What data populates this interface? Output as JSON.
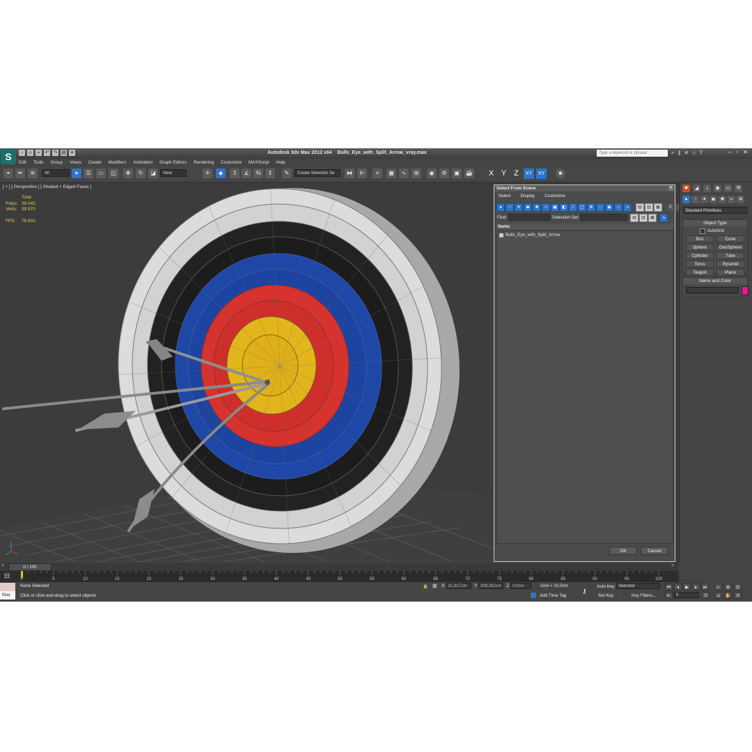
{
  "title": {
    "app": "Autodesk 3ds Max  2012 x64",
    "file": "Bulls_Eye_with_Split_Arrow_vray.max",
    "search_placeholder": "Type a keyword or phrase"
  },
  "menu": [
    "Edit",
    "Tools",
    "Group",
    "Views",
    "Create",
    "Modifiers",
    "Animation",
    "Graph Editors",
    "Rendering",
    "Customize",
    "MAXScript",
    "Help"
  ],
  "toolbar": {
    "filter_value": "All",
    "view_value": "View",
    "selection_set_placeholder": "Create Selection Se",
    "snap_labels": [
      "3",
      "%"
    ],
    "axes": [
      "X",
      "Y",
      "Z",
      "XY",
      "XY"
    ]
  },
  "viewport": {
    "label": "[ + ] [ Perspective ] [ Shaded + Edged Faces ]",
    "stats": {
      "total_label": "Total",
      "polys_label": "Polys:",
      "polys_value": "39 042",
      "verts_label": "Verts:",
      "verts_value": "39 970",
      "fps_label": "FPS:",
      "fps_value": "76.902"
    }
  },
  "dialog": {
    "title": "Select From Scene",
    "menu": [
      "Select",
      "Display",
      "Customize"
    ],
    "find_label": "Find:",
    "selection_set_label": "Selection Set:",
    "column_name": "Name",
    "items": [
      "Bulls_Eye_with_Split_Arrow"
    ],
    "ok": "OK",
    "cancel": "Cancel"
  },
  "command_panel": {
    "category": "Standard Primitives",
    "object_type_title": "Object Type",
    "autogrid": "AutoGrid",
    "buttons": [
      "Box",
      "Cone",
      "Sphere",
      "GeoSphere",
      "Cylinder",
      "Tube",
      "Torus",
      "Pyramid",
      "Teapot",
      "Plane"
    ],
    "name_color_title": "Name and Color",
    "object_color": "#e81a8c"
  },
  "timeline": {
    "slider": "0 / 100",
    "ticks": [
      "0",
      "5",
      "10",
      "15",
      "20",
      "25",
      "30",
      "35",
      "40",
      "45",
      "50",
      "55",
      "60",
      "65",
      "70",
      "75",
      "80",
      "85",
      "90",
      "95",
      "100"
    ]
  },
  "status": {
    "maxscript_label": "Max",
    "selection": "None Selected",
    "prompt": "Click or click-and-drag to select objects",
    "x_label": "X:",
    "x_value": "81,817cm",
    "y_label": "Y:",
    "y_value": "309,262cm",
    "z_label": "Z:",
    "z_value": "0,0cm",
    "grid": "Grid = 10,0cm",
    "add_time_tag": "Add Time Tag",
    "auto_key": "Auto Key",
    "set_key": "Set Key",
    "key_mode_value": "Selected",
    "key_filters": "Key Filters...",
    "frame_value": "0"
  },
  "colors": {
    "target_gold": "#e3b51c",
    "target_red": "#d6322e",
    "target_blue": "#1f47a8",
    "target_black": "#1f1f1f",
    "target_white": "#d9d9d9",
    "accent_blue": "#2e74c9"
  }
}
